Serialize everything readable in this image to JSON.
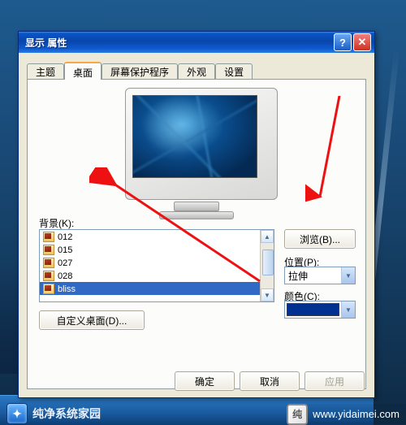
{
  "window": {
    "title": "显示 属性"
  },
  "tabs": [
    "主题",
    "桌面",
    "屏幕保护程序",
    "外观",
    "设置"
  ],
  "selected_tab": 1,
  "background": {
    "label": "背景(K):",
    "items": [
      "012",
      "015",
      "027",
      "028",
      "bliss"
    ],
    "selected": 4
  },
  "browse": {
    "label": "浏览(B)..."
  },
  "position": {
    "label": "位置(P):",
    "value": "拉伸"
  },
  "color": {
    "label": "颜色(C):",
    "value": "#003090"
  },
  "custom": {
    "label": "自定义桌面(D)..."
  },
  "buttons": {
    "ok": "确定",
    "cancel": "取消",
    "apply": "应用"
  },
  "titlebar": {
    "help": "?",
    "close": "✕"
  },
  "watermark": {
    "brand": "纯净系统家园",
    "url": "www.yidaimei.com"
  }
}
